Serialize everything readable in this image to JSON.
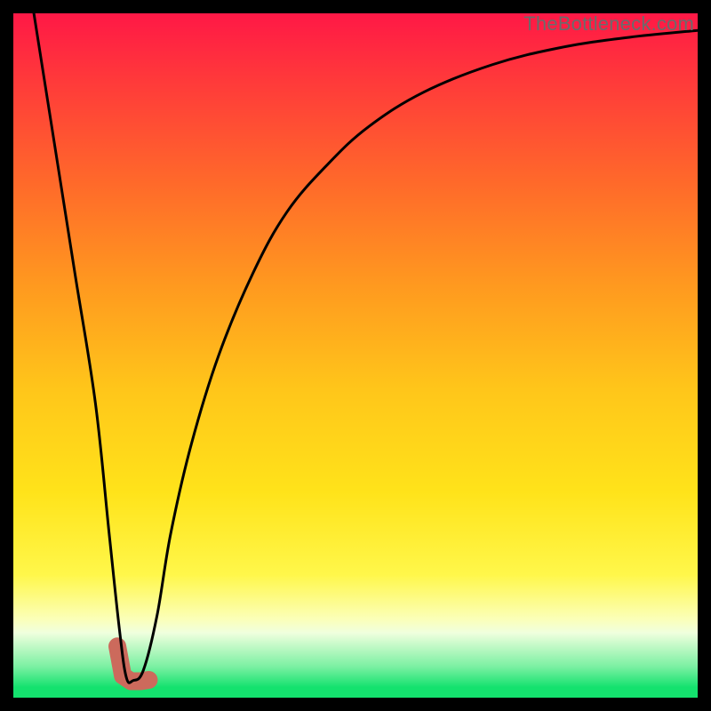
{
  "watermark": "TheBottleneck.com",
  "gradient": {
    "stops": [
      {
        "offset": 0.0,
        "color": "#ff1846"
      },
      {
        "offset": 0.1,
        "color": "#ff3a3a"
      },
      {
        "offset": 0.25,
        "color": "#ff6a2a"
      },
      {
        "offset": 0.4,
        "color": "#ff9a1f"
      },
      {
        "offset": 0.55,
        "color": "#ffc61a"
      },
      {
        "offset": 0.7,
        "color": "#ffe31a"
      },
      {
        "offset": 0.82,
        "color": "#fff74a"
      },
      {
        "offset": 0.885,
        "color": "#fbffb8"
      },
      {
        "offset": 0.905,
        "color": "#f0ffde"
      },
      {
        "offset": 0.955,
        "color": "#7af0a2"
      },
      {
        "offset": 0.985,
        "color": "#14e26e"
      },
      {
        "offset": 1.0,
        "color": "#14e26e"
      }
    ]
  },
  "chart_data": {
    "type": "line",
    "title": "",
    "xlabel": "",
    "ylabel": "",
    "xlim": [
      0,
      100
    ],
    "ylim": [
      0,
      100
    ],
    "annotation": "Bottleneck percentage curve with highlighted minimum region",
    "series": [
      {
        "name": "bottleneck-curve",
        "x": [
          3,
          6,
          9,
          12,
          14,
          15.5,
          16.5,
          17.5,
          19,
          21,
          23,
          26,
          30,
          35,
          40,
          46,
          52,
          60,
          70,
          80,
          90,
          100
        ],
        "y": [
          100,
          81,
          62,
          43,
          24,
          10,
          3,
          2.5,
          4,
          12,
          24,
          37,
          50,
          62,
          71,
          78,
          83.5,
          88.5,
          92.5,
          95,
          96.5,
          97.5
        ]
      }
    ],
    "highlight": {
      "name": "minimum-marker",
      "x": [
        15.2,
        16.0,
        17.2,
        18.6,
        19.8
      ],
      "y": [
        7.5,
        3.2,
        2.4,
        2.4,
        2.6
      ]
    }
  }
}
